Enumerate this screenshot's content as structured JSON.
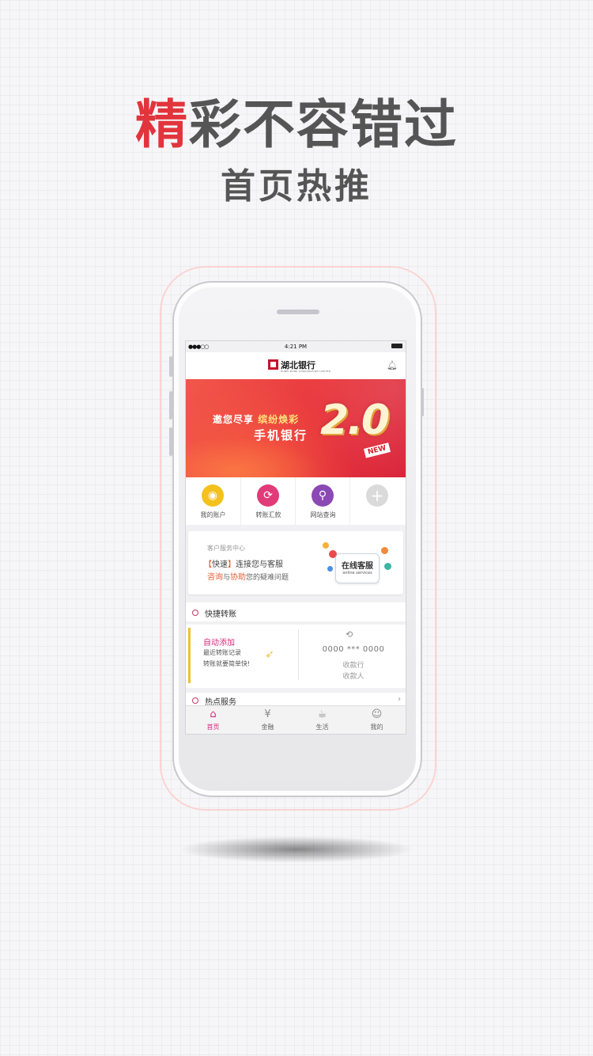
{
  "promo": {
    "headline_accent": "精",
    "headline_rest": "彩不容错过",
    "subheadline": "首页热推"
  },
  "status_bar": {
    "signal": "●●●○○",
    "time": "4:21 PM"
  },
  "app_header": {
    "bank_name": "湖北银行",
    "bank_name_en": "HUBEI BANK CORPORATION LIMITED"
  },
  "banner": {
    "line1_a": "邀您尽享",
    "line1_b": "缤纷焕彩",
    "line2": "手机银行",
    "version": "2.0",
    "badge": "NEW"
  },
  "quick_menu": [
    {
      "label": "我的账户",
      "icon": "account-icon",
      "color": "#f3c11e",
      "glyph": "◉"
    },
    {
      "label": "转账汇款",
      "icon": "transfer-icon",
      "color": "#e23b79",
      "glyph": "⟳"
    },
    {
      "label": "网站查询",
      "icon": "location-icon",
      "color": "#8a49b4",
      "glyph": "⚲"
    },
    {
      "label": "",
      "icon": "add-icon",
      "color": "#dadada",
      "glyph": "+"
    }
  ],
  "service_center": {
    "title": "客户服务中心",
    "line1_bracket_open": "【",
    "line1_fast": "快速",
    "line1_bracket_close": "】",
    "line1_rest": "连接您与客服",
    "line2_consult": "咨询",
    "line2_and": "与",
    "line2_help": "协助",
    "line2_rest": "您的疑难问题",
    "bubble_title": "在线客服",
    "bubble_subtitle": "online services"
  },
  "quick_transfer": {
    "section_title": "快捷转账",
    "auto_add": "自动添加",
    "recent_records": "最近转账记录",
    "simple": "转账就要简单快!",
    "account_number": "0000 *** 0000",
    "receiving_bank": "收款行",
    "payee": "收款人"
  },
  "hot_services": {
    "section_title": "热点服务",
    "arrow": "›"
  },
  "tab_bar": [
    {
      "label": "首页",
      "icon": "home-icon",
      "glyph": "⌂",
      "active": true
    },
    {
      "label": "金融",
      "icon": "finance-icon",
      "glyph": "¥"
    },
    {
      "label": "生活",
      "icon": "life-icon",
      "glyph": "☕"
    },
    {
      "label": "我的",
      "icon": "profile-icon",
      "glyph": "☺"
    }
  ],
  "colors": {
    "accent_red": "#e2343c",
    "brand_pink": "#d6287c",
    "banner_red": "#e8373e"
  }
}
